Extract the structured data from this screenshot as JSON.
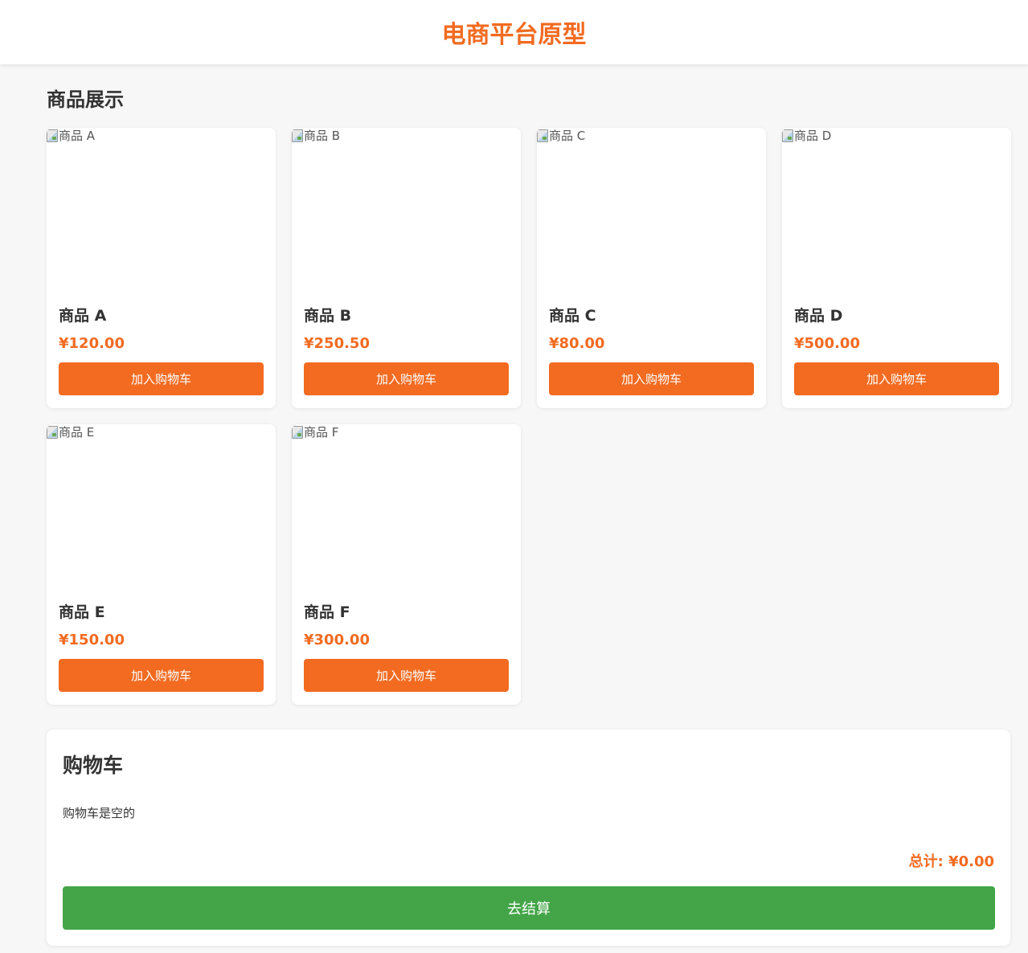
{
  "header": {
    "title": "电商平台原型"
  },
  "products_section": {
    "title": "商品展示"
  },
  "products": [
    {
      "image_alt": "商品 A",
      "name": "商品 A",
      "price": "¥120.00",
      "button": "加入购物车"
    },
    {
      "image_alt": "商品 B",
      "name": "商品 B",
      "price": "¥250.50",
      "button": "加入购物车"
    },
    {
      "image_alt": "商品 C",
      "name": "商品 C",
      "price": "¥80.00",
      "button": "加入购物车"
    },
    {
      "image_alt": "商品 D",
      "name": "商品 D",
      "price": "¥500.00",
      "button": "加入购物车"
    },
    {
      "image_alt": "商品 E",
      "name": "商品 E",
      "price": "¥150.00",
      "button": "加入购物车"
    },
    {
      "image_alt": "商品 F",
      "name": "商品 F",
      "price": "¥300.00",
      "button": "加入购物车"
    }
  ],
  "cart": {
    "title": "购物车",
    "empty_message": "购物车是空的",
    "total": "总计: ¥0.00",
    "checkout_label": "去结算"
  },
  "colors": {
    "accent": "#f26b21",
    "checkout": "#43a547",
    "background": "#f7f7f7"
  },
  "icons": {
    "image_placeholder": "broken-image-icon"
  }
}
